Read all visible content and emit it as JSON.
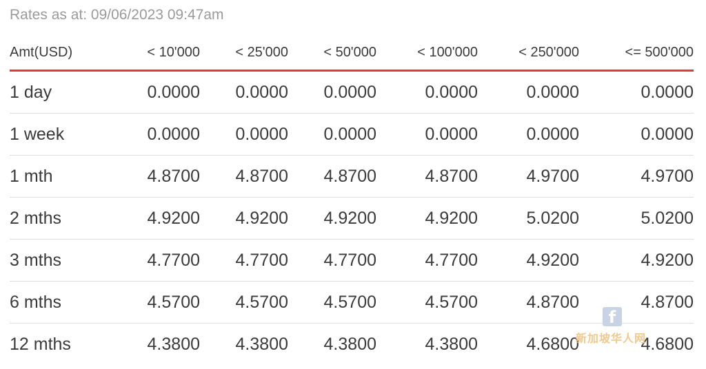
{
  "rates_as_at": "Rates as at: 09/06/2023 09:47am",
  "table": {
    "headers": [
      "Amt(USD)",
      "< 10'000",
      "< 25'000",
      "< 50'000",
      "< 100'000",
      "< 250'000",
      "<= 500'000"
    ],
    "rows": [
      {
        "label": "1 day",
        "values": [
          "0.0000",
          "0.0000",
          "0.0000",
          "0.0000",
          "0.0000",
          "0.0000"
        ]
      },
      {
        "label": "1 week",
        "values": [
          "0.0000",
          "0.0000",
          "0.0000",
          "0.0000",
          "0.0000",
          "0.0000"
        ]
      },
      {
        "label": "1 mth",
        "values": [
          "4.8700",
          "4.8700",
          "4.8700",
          "4.8700",
          "4.9700",
          "4.9700"
        ]
      },
      {
        "label": "2 mths",
        "values": [
          "4.9200",
          "4.9200",
          "4.9200",
          "4.9200",
          "5.0200",
          "5.0200"
        ]
      },
      {
        "label": "3 mths",
        "values": [
          "4.7700",
          "4.7700",
          "4.7700",
          "4.7700",
          "4.9200",
          "4.9200"
        ]
      },
      {
        "label": "6 mths",
        "values": [
          "4.5700",
          "4.5700",
          "4.5700",
          "4.5700",
          "4.8700",
          "4.8700"
        ]
      },
      {
        "label": "12 mths",
        "values": [
          "4.3800",
          "4.3800",
          "4.3800",
          "4.3800",
          "4.6800",
          "4.6800"
        ]
      }
    ]
  },
  "watermark": {
    "icon": "facebook-icon",
    "icon_glyph": "f",
    "text": "新加坡华人网"
  },
  "colors": {
    "header_rule": "#e0383e",
    "row_divider": "#dddddd",
    "muted_text": "#9a9a9a",
    "body_text": "#3a3a3a"
  }
}
